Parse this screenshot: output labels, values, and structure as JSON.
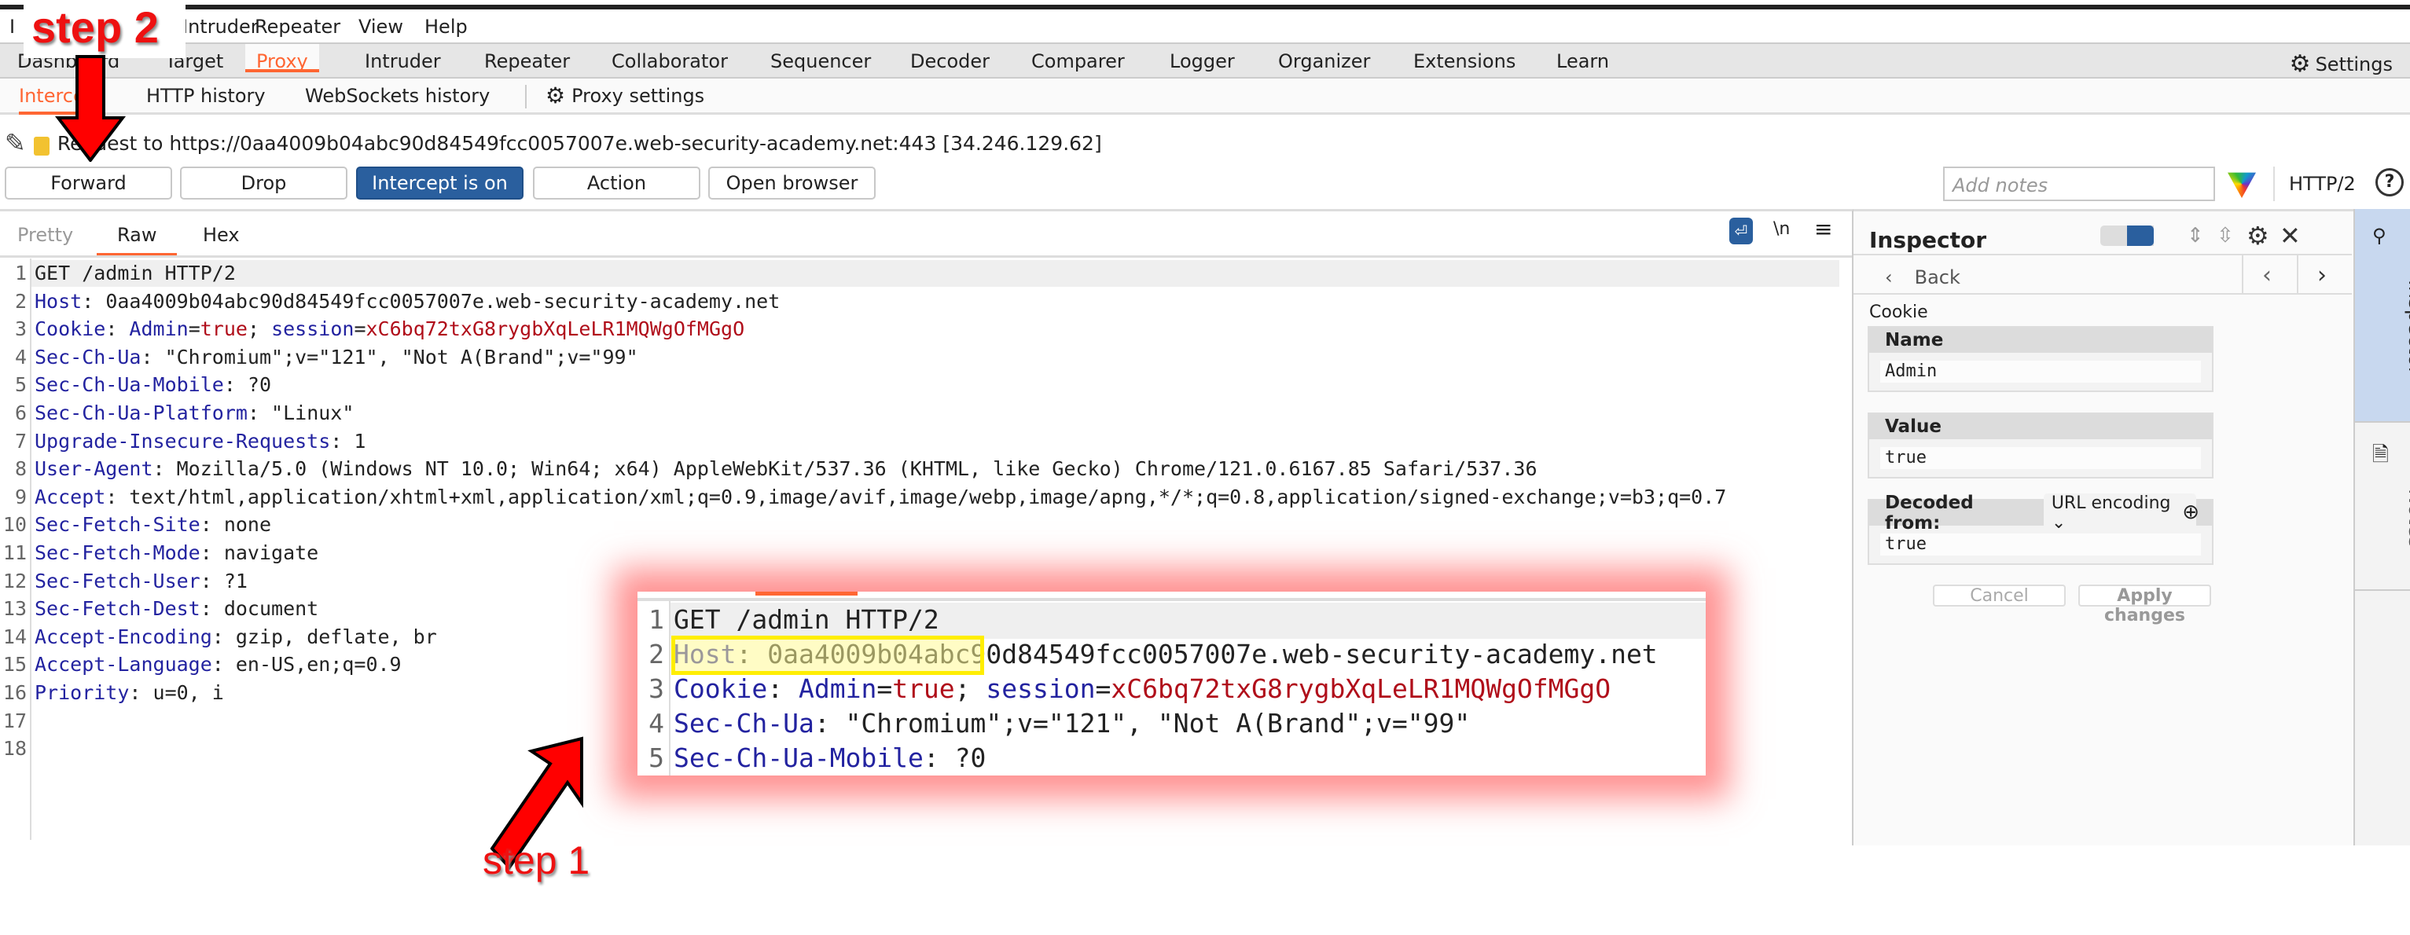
{
  "menu": [
    "Intruder",
    "Repeater",
    "View",
    "Help"
  ],
  "tabs": [
    "Dashboard",
    "Target",
    "Proxy",
    "Intruder",
    "Repeater",
    "Collaborator",
    "Sequencer",
    "Decoder",
    "Comparer",
    "Logger",
    "Organizer",
    "Extensions",
    "Learn"
  ],
  "active_tab": "Proxy",
  "settings_label": "Settings",
  "subtabs": [
    "Intercept",
    "HTTP history",
    "WebSockets history"
  ],
  "proxy_settings": "Proxy settings",
  "request_line": "Request to https://0aa4009b04abc90d84549fcc0057007e.web-security-academy.net:443  [34.246.129.62]",
  "buttons": {
    "forward": "Forward",
    "drop": "Drop",
    "intercept": "Intercept is on",
    "action": "Action",
    "open_browser": "Open browser"
  },
  "notes_placeholder": "Add notes",
  "protocol": "HTTP/2",
  "editor_tabs": [
    "Pretty",
    "Raw",
    "Hex"
  ],
  "editor_newline_label": "\\n",
  "lines": [
    [
      [
        "GET /admin HTTP/2",
        "p"
      ]
    ],
    [
      [
        "Host",
        "k"
      ],
      [
        ": 0aa4009b04abc90d84549fcc0057007e.web-security-academy.net",
        "p"
      ]
    ],
    [
      [
        "Cookie",
        "k"
      ],
      [
        ": ",
        "p"
      ],
      [
        "Admin",
        "k"
      ],
      [
        "=",
        "p"
      ],
      [
        "true",
        "v"
      ],
      [
        "; ",
        "p"
      ],
      [
        "session",
        "k"
      ],
      [
        "=",
        "p"
      ],
      [
        "xC6bq72txG8rygbXqLeLR1MQWgOfMGgO",
        "v"
      ]
    ],
    [
      [
        "Sec-Ch-Ua",
        "k"
      ],
      [
        ": \"Chromium\";v=\"121\", \"Not A(Brand\";v=\"99\"",
        "p"
      ]
    ],
    [
      [
        "Sec-Ch-Ua-Mobile",
        "k"
      ],
      [
        ": ?0",
        "p"
      ]
    ],
    [
      [
        "Sec-Ch-Ua-Platform",
        "k"
      ],
      [
        ": \"Linux\"",
        "p"
      ]
    ],
    [
      [
        "Upgrade-Insecure-Requests",
        "k"
      ],
      [
        ": 1",
        "p"
      ]
    ],
    [
      [
        "User-Agent",
        "k"
      ],
      [
        ": Mozilla/5.0 (Windows NT 10.0; Win64; x64) AppleWebKit/537.36 (KHTML, like Gecko) Chrome/121.0.6167.85 Safari/537.36",
        "p"
      ]
    ],
    [
      [
        "Accept",
        "k"
      ],
      [
        ": text/html,application/xhtml+xml,application/xml;q=0.9,image/avif,image/webp,image/apng,*/*;q=0.8,application/signed-exchange;v=b3;q=0.7",
        "p"
      ]
    ],
    [
      [
        "Sec-Fetch-Site",
        "k"
      ],
      [
        ": none",
        "p"
      ]
    ],
    [
      [
        "Sec-Fetch-Mode",
        "k"
      ],
      [
        ": navigate",
        "p"
      ]
    ],
    [
      [
        "Sec-Fetch-User",
        "k"
      ],
      [
        ": ?1",
        "p"
      ]
    ],
    [
      [
        "Sec-Fetch-Dest",
        "k"
      ],
      [
        ": document",
        "p"
      ]
    ],
    [
      [
        "Accept-Encoding",
        "k"
      ],
      [
        ": gzip, deflate, br",
        "p"
      ]
    ],
    [
      [
        "Accept-Language",
        "k"
      ],
      [
        ": en-US,en;q=0.9",
        "p"
      ]
    ],
    [
      [
        "Priority",
        "k"
      ],
      [
        ": u=0, i",
        "p"
      ]
    ],
    [],
    []
  ],
  "inspector": {
    "title": "Inspector",
    "back": "Back",
    "section": "Cookie",
    "name_label": "Name",
    "name_value": "Admin",
    "value_label": "Value",
    "value_value": "true",
    "decoded_label": "Decoded from:",
    "decoded_option": "URL encoding",
    "decoded_value": "true",
    "cancel": "Cancel",
    "apply": "Apply changes"
  },
  "side_tabs": {
    "inspector": "Inspector",
    "notes": "Notes"
  },
  "annotations": {
    "step1": "step 1",
    "step2": "step 2"
  },
  "colors": {
    "accent": "#ff6633",
    "primary_button": "#2a5f9e",
    "header_name": "#2323a0",
    "header_value": "#b00e1a",
    "highlight": "#ffee00",
    "annotation": "#ee1111"
  }
}
